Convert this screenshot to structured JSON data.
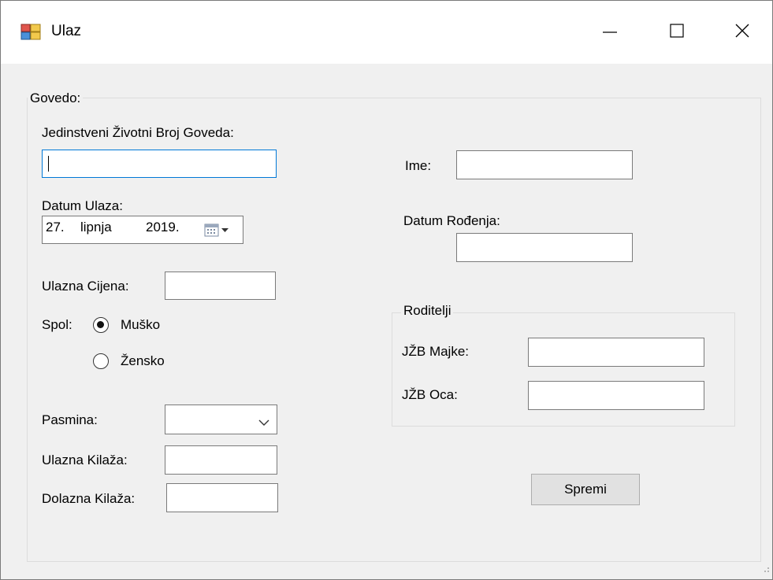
{
  "window": {
    "title": "Ulaz",
    "icon": "app-window-icon"
  },
  "controls": {
    "minimize": "minimize-icon",
    "maximize": "maximize-icon",
    "close": "close-icon"
  },
  "goveda_group": {
    "legend": "Govedo:"
  },
  "fields": {
    "jzbg_label": "Jedinstveni Životni Broj Goveda:",
    "jzbg_value": "",
    "datum_ulaza_label": "Datum Ulaza:",
    "datum_ulaza": {
      "day": "27.",
      "month": "lipnja",
      "year": "2019."
    },
    "ulazna_cijena_label": "Ulazna Cijena:",
    "ulazna_cijena_value": "",
    "spol_label": "Spol:",
    "spol_options": [
      "Muško",
      "Žensko"
    ],
    "spol_selected": "Muško",
    "pasmina_label": "Pasmina:",
    "pasmina_value": "",
    "ulazna_kilaza_label": "Ulazna Kilaža:",
    "ulazna_kilaza_value": "",
    "dolazna_kilaza_label": "Dolazna Kilaža:",
    "dolazna_kilaza_value": "",
    "ime_label": "Ime:",
    "ime_value": "",
    "datum_rodjenja_label": "Datum Rođenja:",
    "datum_rodjenja_value": ""
  },
  "roditelji_group": {
    "legend": "Roditelji",
    "jzb_majke_label": "JŽB Majke:",
    "jzb_majke_value": "",
    "jzb_oca_label": "JŽB Oca:",
    "jzb_oca_value": ""
  },
  "actions": {
    "save_label": "Spremi"
  },
  "colors": {
    "focus_border": "#0078d7",
    "window_bg": "#f0f0f0",
    "titlebar_bg": "#ffffff"
  }
}
